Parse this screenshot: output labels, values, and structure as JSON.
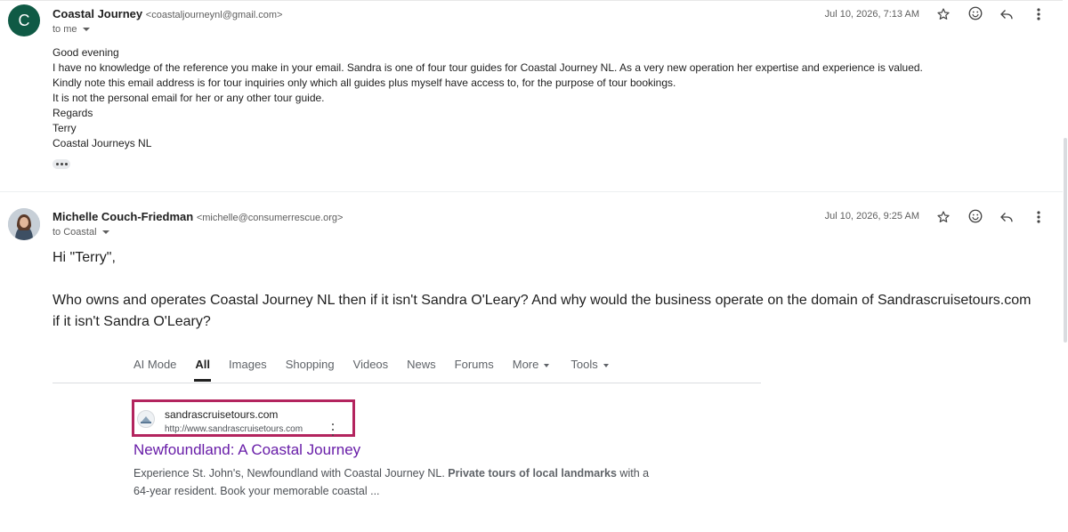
{
  "email1": {
    "avatar_letter": "C",
    "sender_name": "Coastal Journey",
    "sender_email": "<coastaljourneynl@gmail.com>",
    "recipient": "to me",
    "date": "Jul 10, 2026, 7:13 AM",
    "body_lines": [
      "Good evening",
      "I have no knowledge of the reference you make in your email.  Sandra is one of four tour guides for Coastal Journey NL.  As a very new operation her expertise and experience is valued.",
      "Kindly note this email address is for tour inquiries only which all guides plus myself have access to, for the purpose of tour bookings.",
      "It is not the personal email for her or any other tour guide.",
      "Regards",
      "Terry",
      "Coastal Journeys NL"
    ]
  },
  "email2": {
    "sender_name": "Michelle Couch-Friedman",
    "sender_email": "<michelle@consumerrescue.org>",
    "recipient": "to Coastal",
    "date": "Jul 10, 2026, 9:25 AM",
    "greeting": "Hi \"Terry\",",
    "paragraph_line1": "Who owns and operates Coastal Journey NL then if it isn't Sandra O'Leary?  And why would the business operate on the domain of Sandrascruisetours.com",
    "paragraph_line2": "if it isn't Sandra O'Leary?"
  },
  "search": {
    "tabs": [
      {
        "label": "AI Mode"
      },
      {
        "label": "All"
      },
      {
        "label": "Images"
      },
      {
        "label": "Shopping"
      },
      {
        "label": "Videos"
      },
      {
        "label": "News"
      },
      {
        "label": "Forums"
      },
      {
        "label": "More"
      },
      {
        "label": "Tools"
      }
    ],
    "result": {
      "site_name": "sandrascruisetours.com",
      "site_url": "http://www.sandrascruisetours.com",
      "title": "Newfoundland: A Coastal Journey",
      "snippet_start": "Experience St. John's, Newfoundland with Coastal Journey NL. ",
      "snippet_bold": "Private tours of local landmarks",
      "snippet_end": " with a 64-year resident. Book your memorable coastal ..."
    }
  },
  "colors": {
    "avatar_bg": "#0f5a45",
    "highlight_border": "#b3245e",
    "result_title": "#681da8"
  },
  "icons": [
    "star-icon",
    "emoji-icon",
    "reply-icon",
    "more-vert-icon"
  ]
}
